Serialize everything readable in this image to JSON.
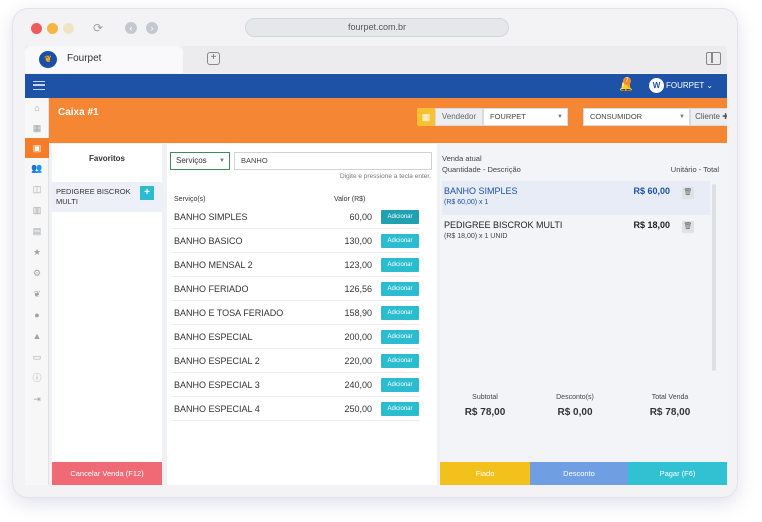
{
  "browser": {
    "url": "fourpet.com.br",
    "tab_title": "Fourpet"
  },
  "topbar": {
    "notification_count": "7",
    "user_label": "FOURPET ⌄"
  },
  "header": {
    "title": "Caixa #1",
    "vendedor_label": "Vendedor",
    "vendedor_value": "FOURPET",
    "cliente_value": "CONSUMIDOR",
    "cliente_button": "Cliente ✚"
  },
  "favorites": {
    "title": "Favoritos",
    "items": [
      {
        "label": "PEDIGREE BISCROK MULTI"
      }
    ],
    "cancel_label": "Cancelar Venda (F12)"
  },
  "products": {
    "category": "Serviços",
    "search_value": "BANHO",
    "hint": "Digite e pressione a tecla enter.",
    "col_service": "Serviço(s)",
    "col_value": "Valor (R$)",
    "add_label": "Adicionar",
    "rows": [
      {
        "name": "BANHO SIMPLES",
        "value": "60,00"
      },
      {
        "name": "BANHO BASICO",
        "value": "130,00"
      },
      {
        "name": "BANHO MENSAL 2",
        "value": "123,00"
      },
      {
        "name": "BANHO FERIADO",
        "value": "126,56"
      },
      {
        "name": "BANHO E TOSA FERIADO",
        "value": "158,90"
      },
      {
        "name": "BANHO ESPECIAL",
        "value": "200,00"
      },
      {
        "name": "BANHO ESPECIAL 2",
        "value": "220,00"
      },
      {
        "name": "BANHO ESPECIAL 3",
        "value": "240,00"
      },
      {
        "name": "BANHO ESPECIAL 4",
        "value": "250,00"
      }
    ]
  },
  "cart": {
    "title": "Venda atual",
    "subtitle_left": "Quantidade - Descrição",
    "subtitle_right": "Unitário - Total",
    "items": [
      {
        "name": "BANHO SIMPLES",
        "detail": "(R$ 60,00) x 1",
        "price": "R$ 60,00"
      },
      {
        "name": "PEDIGREE BISCROK MULTI",
        "detail": "(R$ 18,00) x 1 UNID",
        "price": "R$ 18,00"
      }
    ],
    "subtotal_label": "Subtotal",
    "subtotal_value": "R$ 78,00",
    "discount_label": "Desconto(s)",
    "discount_value": "R$ 0,00",
    "total_label": "Total Venda",
    "total_value": "R$ 78,00",
    "fiado_label": "Fiado",
    "desconto_label": "Desconto",
    "pagar_label": "Pagar (F6)"
  },
  "colors": {
    "accent_orange": "#f58634",
    "brand_blue": "#1e52a7",
    "teal": "#2bbcd0",
    "fiado": "#f2c11c",
    "desconto": "#6f9ee3",
    "pagar": "#30c1d3",
    "cancel": "#ef6a74"
  }
}
